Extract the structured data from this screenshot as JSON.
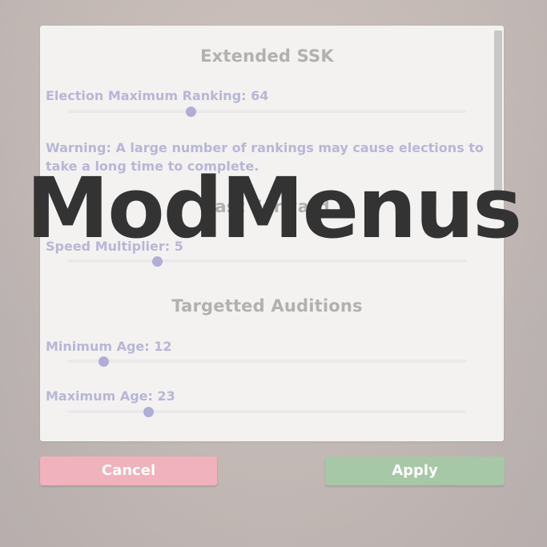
{
  "sections": {
    "ssk": {
      "title": "Extended SSK",
      "ranking_label": "Election Maximum Ranking: 64",
      "ranking_value": 64,
      "ranking_fraction": 0.31,
      "warning": "Warning: A large number of rankings may cause elections to take a long time to complete."
    },
    "fast_forward": {
      "title": "Fast Forward",
      "speed_label": "Speed Multiplier: 5",
      "speed_value": 5,
      "speed_fraction": 0.225
    },
    "auditions": {
      "title": "Targetted Auditions",
      "min_age_label": "Minimum Age: 12",
      "min_age_value": 12,
      "min_age_fraction": 0.092,
      "max_age_label": "Maximum Age: 23",
      "max_age_value": 23,
      "max_age_fraction": 0.203
    }
  },
  "buttons": {
    "cancel": "Cancel",
    "apply": "Apply"
  },
  "overlay": {
    "title": "ModMenus"
  },
  "colors": {
    "panel": "#f3f2f1",
    "label": "#b9b6d6",
    "thumb": "#b0aed6",
    "cancel": "#f0b2bc",
    "apply": "#a6c8a6",
    "overlay_text": "#333333"
  }
}
